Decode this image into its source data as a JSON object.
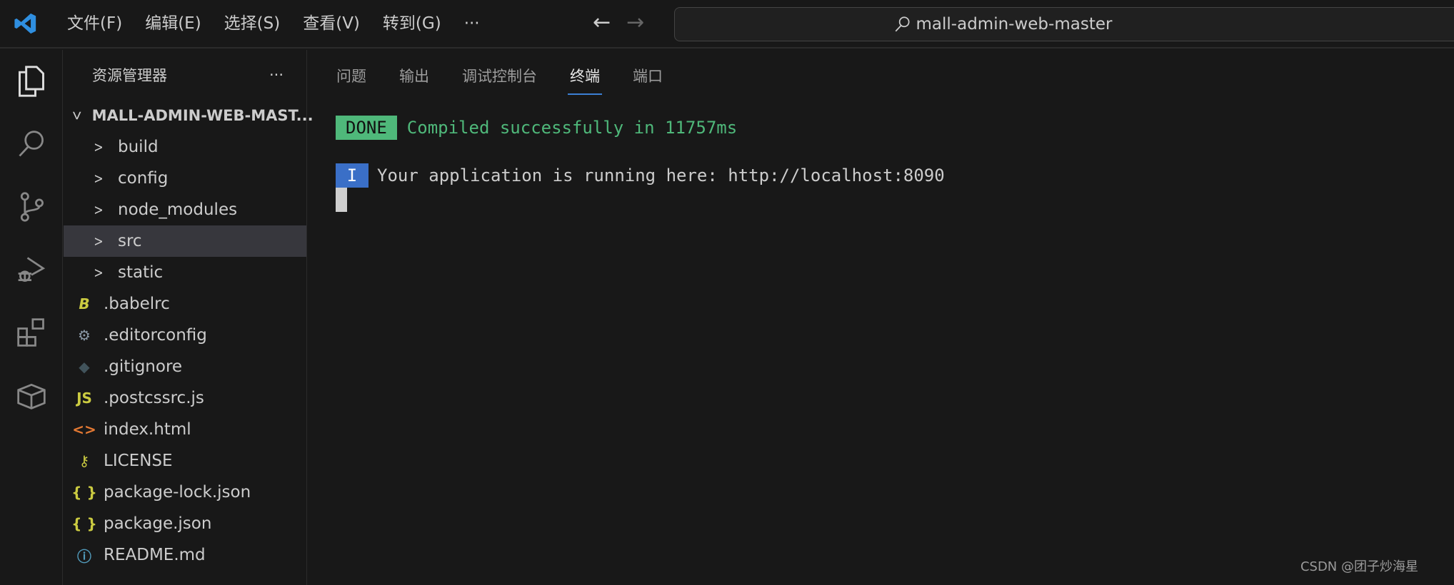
{
  "titlebar": {
    "menus": [
      "文件(F)",
      "编辑(E)",
      "选择(S)",
      "查看(V)",
      "转到(G)",
      "···"
    ],
    "search": "mall-admin-web-master"
  },
  "sidebar": {
    "title": "资源管理器",
    "more": "···",
    "root": "MALL-ADMIN-WEB-MAST...",
    "items": [
      {
        "label": "build",
        "icon": "chevron-right",
        "type": "folder"
      },
      {
        "label": "config",
        "icon": "chevron-right",
        "type": "folder"
      },
      {
        "label": "node_modules",
        "icon": "chevron-right",
        "type": "folder"
      },
      {
        "label": "src",
        "icon": "chevron-right",
        "type": "folder",
        "selected": true
      },
      {
        "label": "static",
        "icon": "chevron-right",
        "type": "folder"
      },
      {
        "label": ".babelrc",
        "icon": "babel",
        "glyph": "B"
      },
      {
        "label": ".editorconfig",
        "icon": "gear",
        "glyph": "⚙"
      },
      {
        "label": ".gitignore",
        "icon": "git",
        "glyph": "◆"
      },
      {
        "label": ".postcssrc.js",
        "icon": "js",
        "glyph": "JS"
      },
      {
        "label": "index.html",
        "icon": "html",
        "glyph": "<>"
      },
      {
        "label": "LICENSE",
        "icon": "key",
        "glyph": "⚷"
      },
      {
        "label": "package-lock.json",
        "icon": "json",
        "glyph": "{ }"
      },
      {
        "label": "package.json",
        "icon": "json",
        "glyph": "{ }"
      },
      {
        "label": "README.md",
        "icon": "info",
        "glyph": "ⓘ"
      }
    ]
  },
  "panel": {
    "tabs": [
      "问题",
      "输出",
      "调试控制台",
      "终端",
      "端口"
    ],
    "active_tab": "终端"
  },
  "terminal": {
    "done_badge": "DONE",
    "done_text": "Compiled successfully in 11757ms",
    "info_badge": "I",
    "info_text": "Your application is running here: http://localhost:8090"
  },
  "colors": {
    "done": "#4fb87a",
    "info": "#3a6fc7",
    "accent": "#3b7fd4"
  },
  "watermark": "CSDN @团子炒海星"
}
